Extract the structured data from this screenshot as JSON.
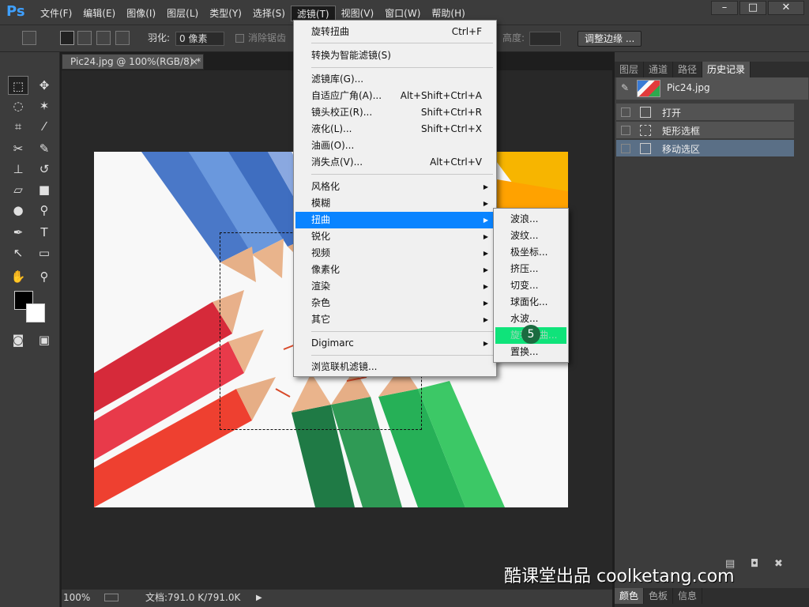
{
  "app": {
    "logo": "Ps"
  },
  "menubar": {
    "items": [
      "文件(F)",
      "编辑(E)",
      "图像(I)",
      "图层(L)",
      "类型(Y)",
      "选择(S)",
      "滤镜(T)",
      "视图(V)",
      "窗口(W)",
      "帮助(H)"
    ],
    "active_index": 6
  },
  "window_buttons": [
    "minimize-icon",
    "maximize-icon",
    "close-icon"
  ],
  "options_bar": {
    "feather_label": "羽化:",
    "feather_value": "0 像素",
    "antialias_label": "消除锯齿",
    "height_label": "高度:",
    "refine_edge_button": "调整边缘 ..."
  },
  "document": {
    "tab_title": "Pic24.jpg @ 100%(RGB/8) *",
    "zoom": "100%",
    "doc_size": "文档:791.0 K/791.0K"
  },
  "right_panel": {
    "tabs": [
      "图层",
      "通道",
      "路径",
      "历史记录"
    ],
    "active_tab_index": 3,
    "snapshot_name": "Pic24.jpg",
    "history": [
      {
        "label": "打开",
        "selected": false
      },
      {
        "label": "矩形选框",
        "selected": false
      },
      {
        "label": "移动选区",
        "selected": true
      }
    ],
    "bottom_tabs": [
      "颜色",
      "色板",
      "信息"
    ]
  },
  "filter_menu": {
    "items": [
      {
        "label": "旋转扭曲",
        "shortcut": "Ctrl+F"
      },
      {
        "label": "转换为智能滤镜(S)"
      },
      {
        "label": "滤镜库(G)..."
      },
      {
        "label": "自适应广角(A)...",
        "shortcut": "Alt+Shift+Ctrl+A"
      },
      {
        "label": "镜头校正(R)...",
        "shortcut": "Shift+Ctrl+R"
      },
      {
        "label": "液化(L)...",
        "shortcut": "Shift+Ctrl+X"
      },
      {
        "label": "油画(O)..."
      },
      {
        "label": "消失点(V)...",
        "shortcut": "Alt+Ctrl+V"
      },
      {
        "label": "风格化",
        "submenu": true
      },
      {
        "label": "模糊",
        "submenu": true
      },
      {
        "label": "扭曲",
        "submenu": true,
        "highlighted": true
      },
      {
        "label": "锐化",
        "submenu": true
      },
      {
        "label": "视频",
        "submenu": true
      },
      {
        "label": "像素化",
        "submenu": true
      },
      {
        "label": "渲染",
        "submenu": true
      },
      {
        "label": "杂色",
        "submenu": true
      },
      {
        "label": "其它",
        "submenu": true
      },
      {
        "label": "Digimarc",
        "submenu": true
      },
      {
        "label": "浏览联机滤镜..."
      }
    ]
  },
  "distort_submenu": {
    "items": [
      "波浪...",
      "波纹...",
      "极坐标...",
      "挤压...",
      "切变...",
      "球面化...",
      "水波...",
      "旋转扭曲...",
      "置换..."
    ],
    "highlighted_index": 7
  },
  "step_badge": "5",
  "watermark": "酷课堂出品 coolketang.com",
  "colors": {
    "highlight_blue": "#0a84ff",
    "highlight_green": "#0fe37a",
    "ui_dark": "#3c3c3c"
  }
}
